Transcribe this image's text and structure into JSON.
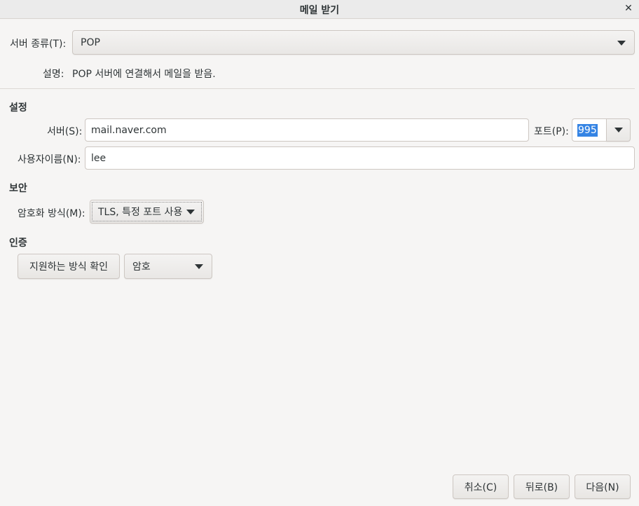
{
  "window": {
    "title": "메일 받기"
  },
  "server_type": {
    "label": "서버 종류(T):",
    "value": "POP"
  },
  "description": {
    "label": "설명:",
    "text": "POP 서버에 연결해서 메일을 받음."
  },
  "settings": {
    "heading": "설정",
    "server_label": "서버(S):",
    "server_value": "mail.naver.com",
    "port_label": "포트(P):",
    "port_value": "995",
    "username_label": "사용자이름(N):",
    "username_value": "lee"
  },
  "security": {
    "heading": "보안",
    "encryption_label": "암호화 방식(M):",
    "encryption_value": "TLS, 특정 포트 사용"
  },
  "auth": {
    "heading": "인증",
    "check_button": "지원하는 방식 확인",
    "method_value": "암호"
  },
  "buttons": {
    "cancel": "취소(C)",
    "back": "뒤로(B)",
    "next": "다음(N)"
  }
}
